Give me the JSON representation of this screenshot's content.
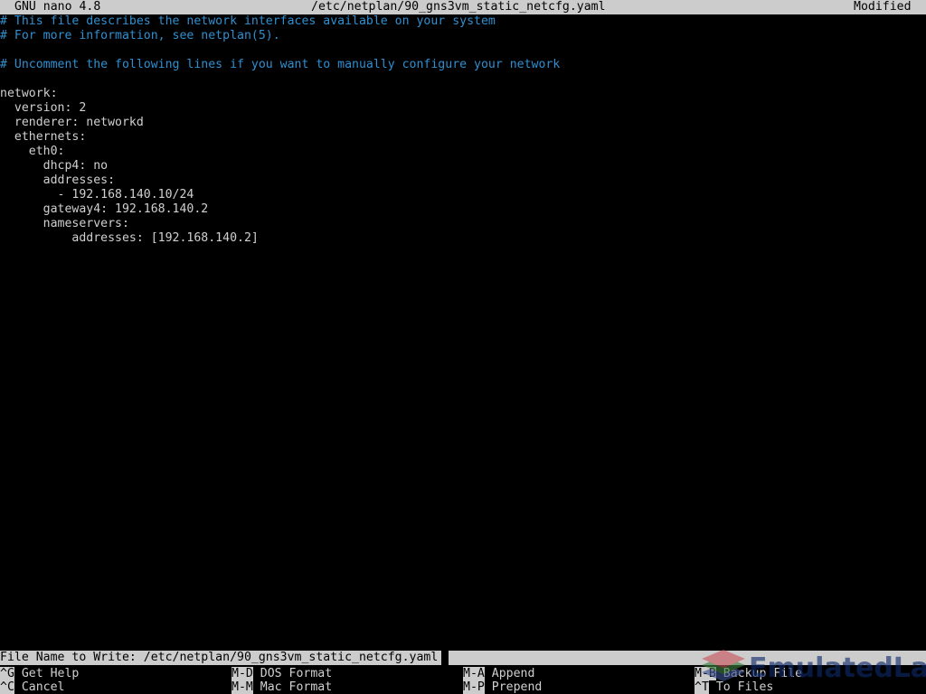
{
  "titlebar": {
    "app": "GNU nano 4.8",
    "filename": "/etc/netplan/90_gns3vm_static_netcfg.yaml",
    "modified": "Modified"
  },
  "editor": {
    "lines": [
      {
        "text": "# This file describes the network interfaces available on your system",
        "kind": "comment"
      },
      {
        "text": "# For more information, see netplan(5).",
        "kind": "comment"
      },
      {
        "text": "",
        "kind": "blank"
      },
      {
        "text": "# Uncomment the following lines if you want to manually configure your network",
        "kind": "comment"
      },
      {
        "text": "",
        "kind": "blank"
      },
      {
        "text": "network:",
        "kind": "text"
      },
      {
        "text": "  version: 2",
        "kind": "text"
      },
      {
        "text": "  renderer: networkd",
        "kind": "text"
      },
      {
        "text": "  ethernets:",
        "kind": "text"
      },
      {
        "text": "    eth0:",
        "kind": "text"
      },
      {
        "text": "      dhcp4: no",
        "kind": "text"
      },
      {
        "text": "      addresses:",
        "kind": "text"
      },
      {
        "text": "        - 192.168.140.10/24",
        "kind": "text"
      },
      {
        "text": "      gateway4: 192.168.140.2",
        "kind": "text"
      },
      {
        "text": "      nameservers:",
        "kind": "text"
      },
      {
        "text": "          addresses: [192.168.140.2]",
        "kind": "text"
      }
    ]
  },
  "prompt": {
    "label": "File Name to Write: ",
    "value": "/etc/netplan/90_gns3vm_static_netcfg.yaml"
  },
  "shortcuts": [
    {
      "key": "^G",
      "label": " Get Help",
      "col": 0,
      "row": 0
    },
    {
      "key": "^C",
      "label": " Cancel",
      "col": 0,
      "row": 1
    },
    {
      "key": "M-D",
      "label": " DOS Format",
      "col": 32,
      "row": 0
    },
    {
      "key": "M-M",
      "label": " Mac Format",
      "col": 32,
      "row": 1
    },
    {
      "key": "M-A",
      "label": " Append",
      "col": 64,
      "row": 0
    },
    {
      "key": "M-P",
      "label": " Prepend",
      "col": 64,
      "row": 1
    },
    {
      "key": "M-B",
      "label": " Backup File",
      "col": 96,
      "row": 0
    },
    {
      "key": "^T",
      "label": " To Files",
      "col": 96,
      "row": 1
    }
  ],
  "watermark": {
    "text": "EmulatedLab",
    "logo_colors": [
      "#c9545a",
      "#3f7f3f",
      "#3b4f8f"
    ]
  },
  "colors": {
    "background": "#000000",
    "foreground": "#d0d0d0",
    "comment": "#2f8fd1",
    "bar_background": "#cccccc",
    "bar_foreground": "#000000"
  }
}
